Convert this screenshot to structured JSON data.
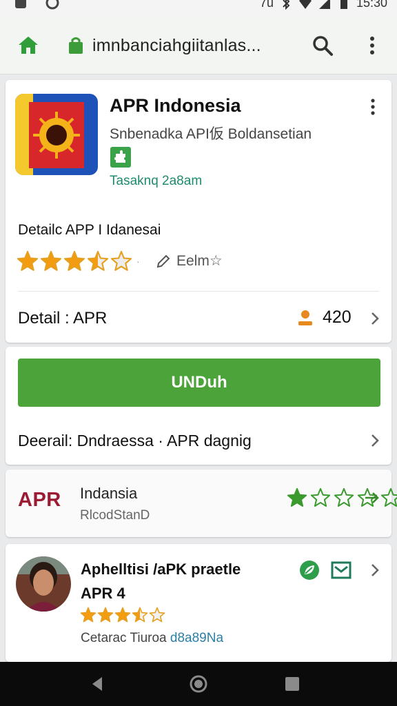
{
  "status_bar": {
    "signal_text": "7ü",
    "time": "15:30"
  },
  "browser": {
    "url": "imnbanciahgiitanlas..."
  },
  "app_card": {
    "title": "APR Indonesia",
    "developer": "Snbenadka API仮 Boldansetian",
    "tagline": "Tasaknq 2a8am",
    "detail_title": "Detailc APP I Idanesai",
    "rating": 3.5,
    "review_label": "Eelm☆",
    "detail_label": "Detail : APR",
    "count": "420"
  },
  "download": {
    "button_label": "UNDuh",
    "row_label": "Deerail: Dndraessa · APR dagnig"
  },
  "related": {
    "logo": "APR",
    "title": "Indansia",
    "subtitle": "RlcodStanD",
    "rating": 1
  },
  "review": {
    "title": "Aphelltisi /aPK praetle",
    "subtitle": "APR 4",
    "rating": 3.5,
    "meta_prefix": "Cetarac Tiuroa ",
    "meta_highlight": "d8a89Na"
  },
  "colors": {
    "accent": "#4ba33a",
    "star": "#f39c12",
    "apr_logo": "#9b1b33"
  }
}
